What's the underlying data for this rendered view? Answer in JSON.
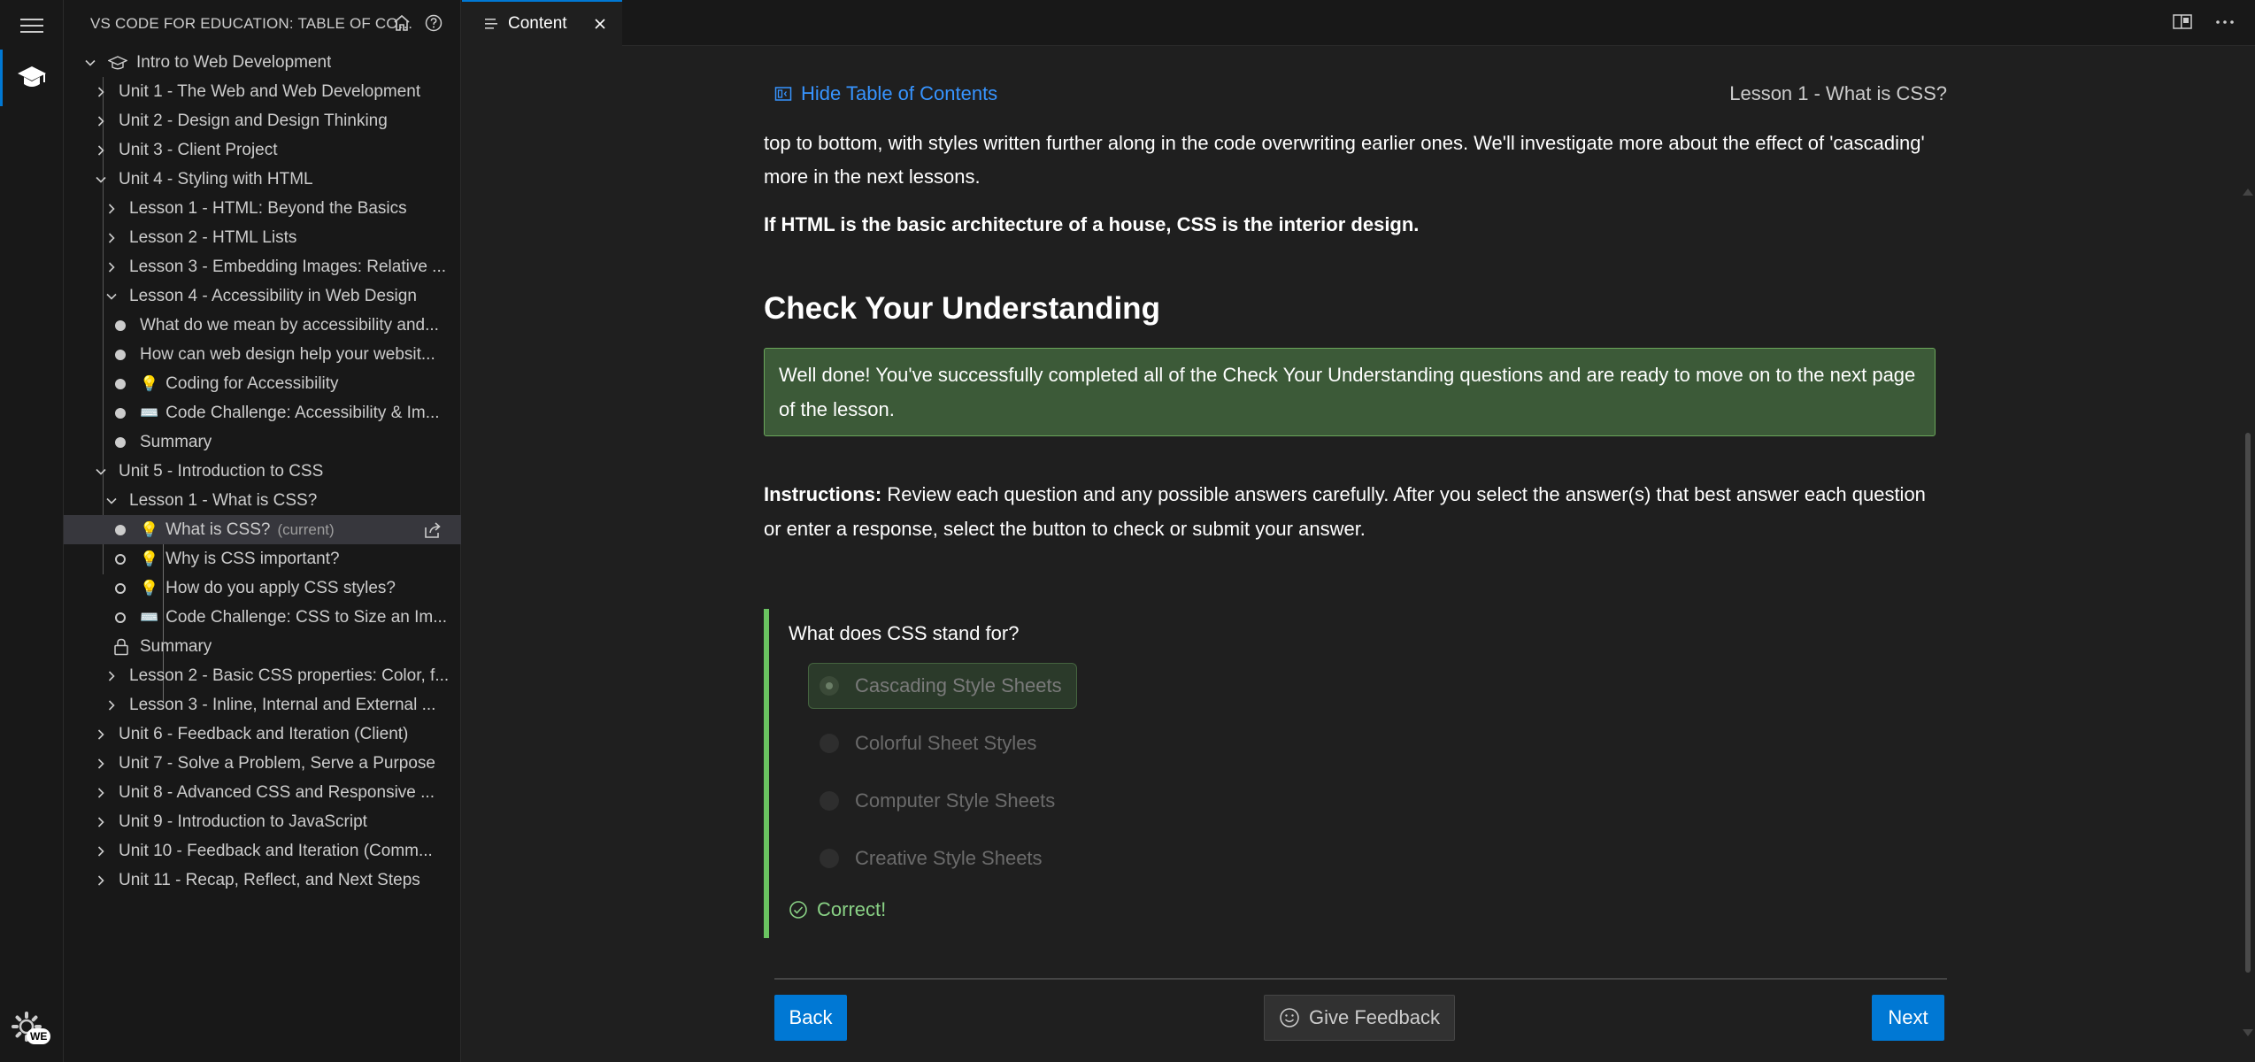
{
  "sidebar": {
    "title": "VS CODE FOR EDUCATION: TABLE OF CON...",
    "course": "Intro to Web Development",
    "items": [
      {
        "label": "Unit 1 - The Web and Web Development"
      },
      {
        "label": "Unit 2 - Design and Design Thinking"
      },
      {
        "label": "Unit 3 - Client Project"
      },
      {
        "label": "Unit 4 - Styling with HTML"
      },
      {
        "label": "Lesson 1 - HTML: Beyond the Basics"
      },
      {
        "label": "Lesson 2 - HTML Lists"
      },
      {
        "label": "Lesson 3 - Embedding Images: Relative ..."
      },
      {
        "label": "Lesson 4 - Accessibility in Web Design"
      },
      {
        "label": "What do we mean by accessibility and..."
      },
      {
        "label": "How can web design help your websit..."
      },
      {
        "label": "Coding for Accessibility"
      },
      {
        "label": "Code Challenge: Accessibility & Im..."
      },
      {
        "label": "Summary"
      },
      {
        "label": "Unit 5 - Introduction to CSS"
      },
      {
        "label": "Lesson 1 - What is CSS?"
      },
      {
        "label": "What is CSS?"
      },
      {
        "label": "Why is CSS important?"
      },
      {
        "label": "How do you apply CSS styles?"
      },
      {
        "label": "Code Challenge: CSS to Size an Im..."
      },
      {
        "label": "Summary"
      },
      {
        "label": "Lesson 2 - Basic CSS properties: Color, f..."
      },
      {
        "label": "Lesson 3 - Inline, Internal and External ..."
      },
      {
        "label": "Unit 6 - Feedback and Iteration (Client)"
      },
      {
        "label": "Unit 7 - Solve a Problem, Serve a Purpose"
      },
      {
        "label": "Unit 8 - Advanced CSS and Responsive ..."
      },
      {
        "label": "Unit 9 - Introduction to JavaScript"
      },
      {
        "label": "Unit 10 - Feedback and Iteration (Comm..."
      },
      {
        "label": "Unit 11 - Recap, Reflect, and Next Steps"
      }
    ],
    "current_tag": "(current)"
  },
  "tab": {
    "label": "Content"
  },
  "activity": {
    "badge": "WE"
  },
  "content": {
    "hide_toc": "Hide Table of Contents",
    "lesson_title": "Lesson 1 - What is CSS?",
    "intro_para": "top to bottom, with styles written further along in the code overwriting earlier ones. We'll investigate more about the effect of 'cascading' more in the next lessons.",
    "analogy": "If HTML is the basic architecture of a house, CSS is the interior design.",
    "section_heading": "Check Your Understanding",
    "success_message": "Well done! You've successfully completed all of the Check Your Understanding questions and are ready to move on to the next page of the lesson.",
    "instructions_label": "Instructions:",
    "instructions_text": " Review each question and any possible answers carefully. After you select the answer(s) that best answer each question or enter a response, select the button to check or submit your answer.",
    "question": "What does CSS stand for?",
    "answers": [
      "Cascading Style Sheets",
      "Colorful Sheet Styles",
      "Computer Style Sheets",
      "Creative Style Sheets"
    ],
    "selected_answer": "Cascading Style Sheets",
    "result": "Correct!",
    "back_label": "Back",
    "feedback_label": "Give Feedback",
    "next_label": "Next"
  },
  "colors": {
    "accent": "#0078d4",
    "link": "#3794ff",
    "success_bg": "#3c5a38",
    "correct": "#89d185"
  }
}
